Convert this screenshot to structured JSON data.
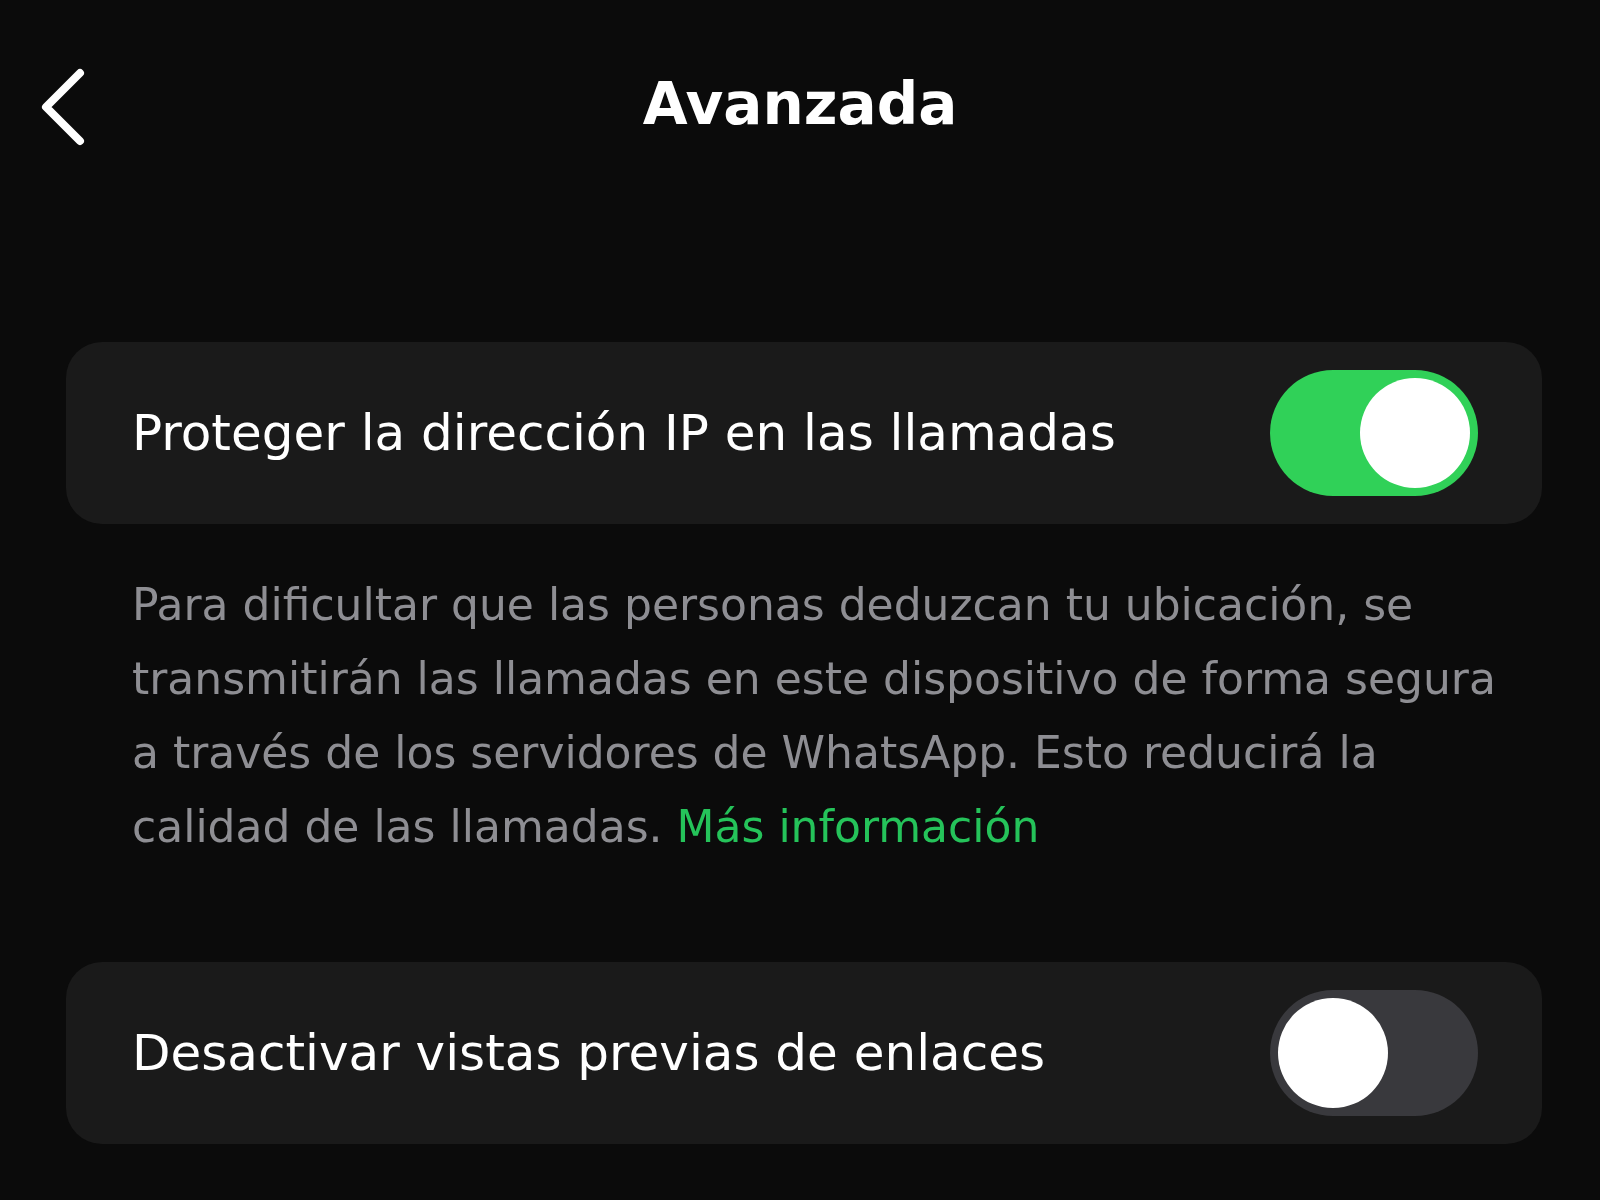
{
  "header": {
    "title": "Avanzada"
  },
  "settings": [
    {
      "label": "Proteger la dirección IP en las llamadas",
      "on": true,
      "description": "Para dificultar que las personas deduzcan tu ubicación, se transmitirán las llamadas en este dispositivo de forma segura a través de los servidores de WhatsApp. Esto reducirá la calidad de las llamadas.",
      "link": "Más información"
    },
    {
      "label": "Desactivar vistas previas de enlaces",
      "on": false
    }
  ]
}
